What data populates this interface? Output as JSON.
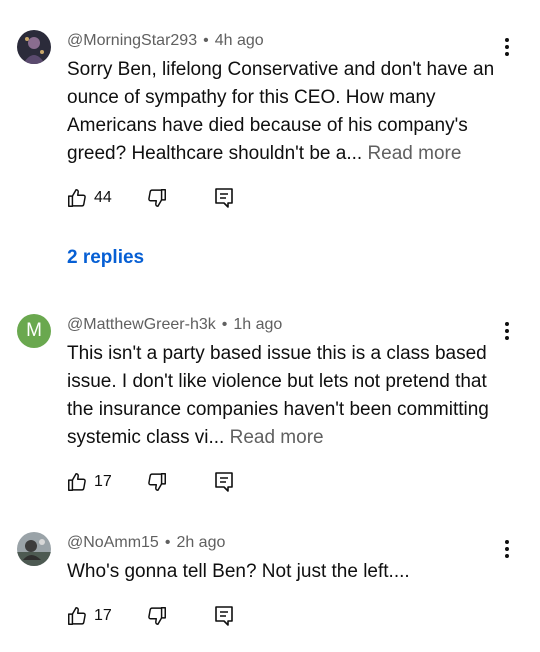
{
  "comments": [
    {
      "author": "@MorningStar293",
      "time": "4h ago",
      "text": "Sorry Ben, lifelong Conservative and don't have an ounce of sympathy for this CEO.  How many Americans have died because of his company's greed?  Healthcare shouldn't be a...",
      "read_more": "Read more",
      "likes": "44",
      "replies_label": "2 replies"
    },
    {
      "author": "@MatthewGreer-h3k",
      "time": "1h ago",
      "avatar_letter": "M",
      "text": "This isn't a party based issue this is a class based issue. I don't like violence but lets not pretend that the insurance companies haven't been committing systemic class vi...",
      "read_more": "Read more",
      "likes": "17"
    },
    {
      "author": "@NoAmm15",
      "time": "2h ago",
      "text": "Who's gonna tell Ben? Not just the left....",
      "likes": "17"
    }
  ],
  "separator": "•",
  "colors": {
    "link_blue": "#065fd4",
    "meta_gray": "#606060",
    "avatar_green": "#6aa84f"
  },
  "icons": [
    "thumbs-up-icon",
    "thumbs-down-icon",
    "reply-icon",
    "more-vert-icon"
  ]
}
